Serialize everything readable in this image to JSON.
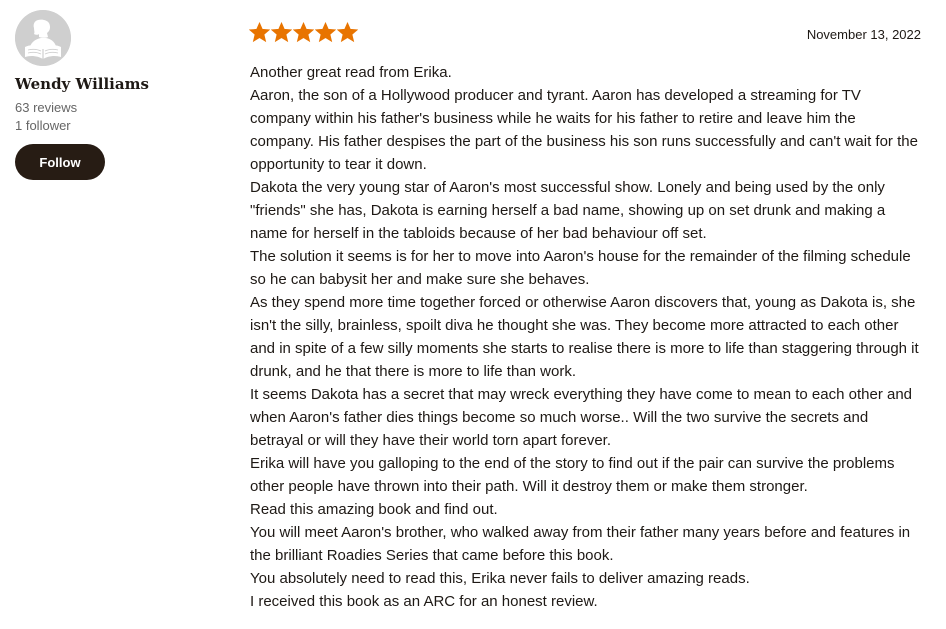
{
  "reviewer": {
    "avatar_icon": "reader-silhouette-icon",
    "name": "Wendy Williams",
    "reviews": "63 reviews",
    "followers": "1 follower",
    "follow_label": "Follow"
  },
  "review": {
    "rating": 5,
    "max_rating": 5,
    "star_color": "#e87400",
    "star_icon": "star-icon",
    "date": "November 13, 2022",
    "paragraphs": [
      "Another great read from Erika.",
      "Aaron, the son of a Hollywood producer and tyrant. Aaron has developed a streaming for TV company within his father's business while he waits for his father to retire and leave him the company. His father despises the part of the business his son runs successfully and can't wait for the opportunity to tear it down.",
      "Dakota the very young star of Aaron's most successful show. Lonely and being used by the only \"friends\" she has, Dakota is earning herself a bad name, showing up on set drunk and making a name for herself in the tabloids because of her bad behaviour off set.",
      "The solution it seems is for her to move into Aaron's house for the remainder of the filming schedule so he can babysit her and make sure she behaves.",
      "As they spend more time together forced or otherwise Aaron discovers that, young as Dakota is, she isn't the silly, brainless, spoilt diva he thought she was. They become more attracted to each other and in spite of a few silly moments she starts to realise there is more to life than staggering through it drunk, and he that there is more to life than work.",
      "It seems Dakota has a secret that may wreck everything they have come to mean to each other and when Aaron's father dies things become so much worse.. Will the two survive the secrets and betrayal or will they have their world torn apart forever.",
      "Erika will have you galloping to the end of the story to find out if the pair can survive the problems other people have thrown into their path. Will it destroy them or make them stronger.",
      "Read this amazing book and find out.",
      "You will meet Aaron's brother, who walked away from their father many years before and features in the brilliant Roadies Series that came before this book.",
      "You absolutely need to read this, Erika never fails to deliver amazing reads.",
      "I received this book as an ARC for an honest review."
    ]
  }
}
